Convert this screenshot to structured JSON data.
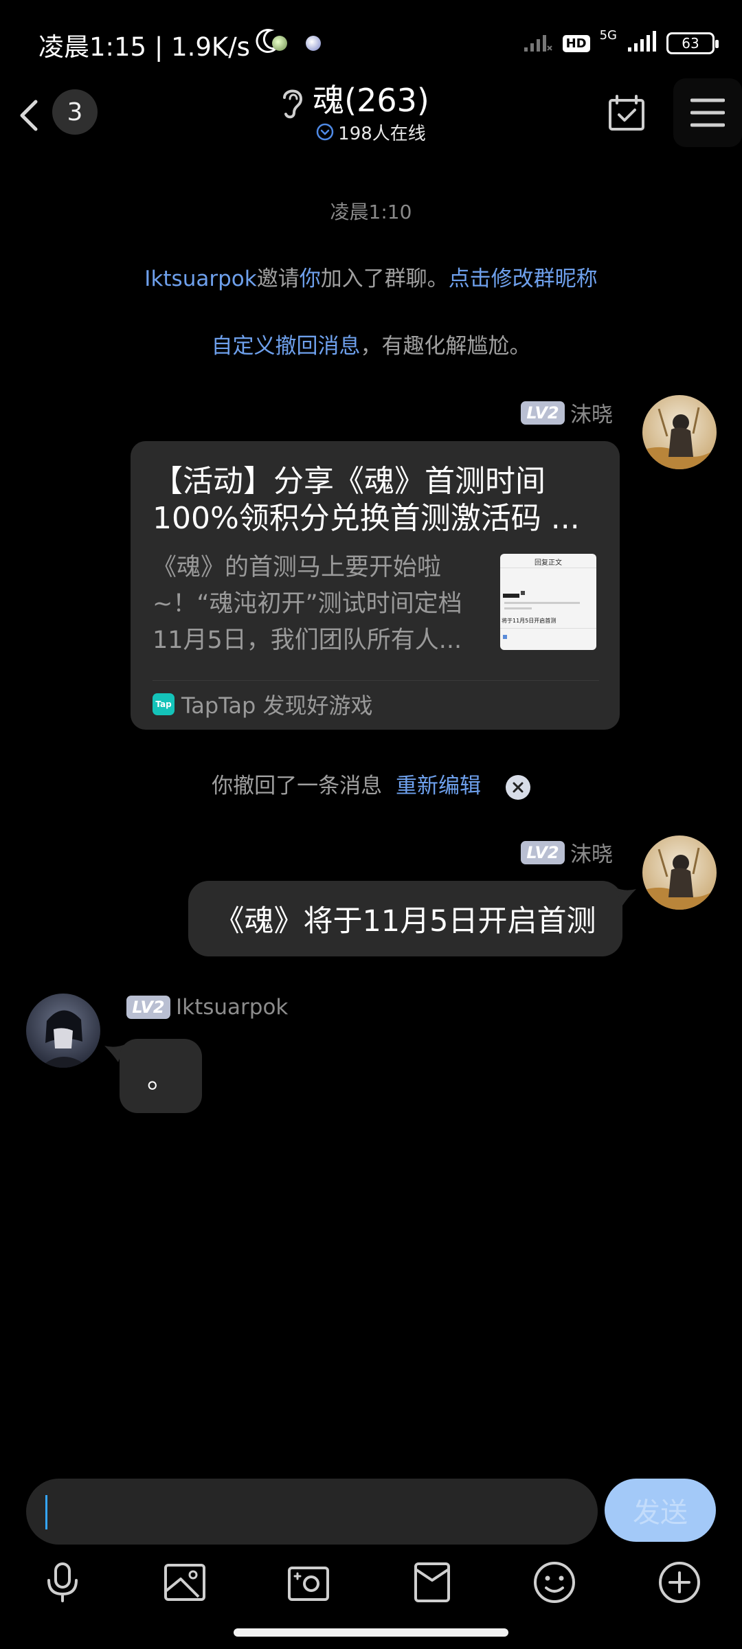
{
  "status": {
    "time": "凌晨1:15",
    "speed": "1.9K/s",
    "hd": "HD",
    "network": "5G",
    "battery": "63"
  },
  "header": {
    "unread_count": "3",
    "title": "魂(263)",
    "online": "198人在线"
  },
  "chat": {
    "timestamp": "凌晨1:10",
    "invite": {
      "inviter": "Iktsuarpok",
      "verb": "邀请",
      "you": "你",
      "rest": "加入了群聊。",
      "link": "点击修改群昵称"
    },
    "tip": {
      "link": "自定义撤回消息",
      "rest": "，有趣化解尴尬。"
    },
    "messages": [
      {
        "sender": "沫晓",
        "level": "LV2",
        "card": {
          "title": "【活动】分享《魂》首测时间100%领积分兑换首测激活码 ...",
          "description": "《魂》的首测马上要开始啦~！“魂沌初开”测试时间定档11月5日，我们团队所有人...",
          "source": "TapTap 发现好游戏",
          "source_logo": "Tap",
          "thumbnail_heading": "回复正文",
          "thumbnail_line": "将于11月5日开启首测"
        }
      },
      {
        "sender": "沫晓",
        "level": "LV2",
        "text": "《魂》将于11月5日开启首测"
      },
      {
        "sender": "Iktsuarpok",
        "level": "LV2",
        "text": "。"
      }
    ],
    "recall": {
      "text": "你撤回了一条消息",
      "link": "重新编辑"
    }
  },
  "input": {
    "value": "",
    "send_label": "发送"
  },
  "colors": {
    "background": "#000000",
    "bubble": "#2b2b2b",
    "link_blue": "#6ea0ec",
    "send_button": "#a3c9f8",
    "level_badge": "#b9bfd2"
  },
  "icons": [
    "back-icon",
    "ear-icon",
    "chevron-down-icon",
    "calendar-check-icon",
    "menu-icon",
    "mic-icon",
    "image-icon",
    "camera-icon",
    "red-packet-icon",
    "emoji-icon",
    "plus-icon"
  ]
}
